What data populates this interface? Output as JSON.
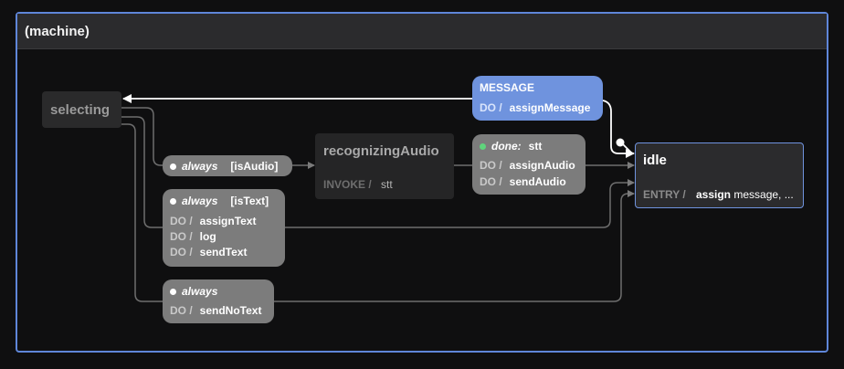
{
  "machine": {
    "title": "(machine)"
  },
  "states": {
    "selecting": {
      "name": "selecting"
    },
    "recognizing": {
      "name": "recognizingAudio",
      "invoke_label": "INVOKE /",
      "invoke_value": "stt"
    },
    "idle": {
      "name": "idle",
      "entry_label": "ENTRY /",
      "entry_action": "assign",
      "entry_rest": " message, ..."
    }
  },
  "transitions": {
    "message": {
      "event": "MESSAGE",
      "do_label": "DO /",
      "action": "assignMessage"
    },
    "always_audio": {
      "event": "always",
      "guard": "[isAudio]"
    },
    "always_text": {
      "event": "always",
      "guard": "[isText]",
      "do_label": "DO /",
      "actions": [
        "assignText",
        "log",
        "sendText"
      ]
    },
    "always_notext": {
      "event": "always",
      "do_label": "DO /",
      "action": "sendNoText"
    },
    "done_stt": {
      "event": "done:",
      "target": "stt",
      "do_label": "DO /",
      "actions": [
        "assignAudio",
        "sendAudio"
      ]
    }
  },
  "colors": {
    "machine_border": "#5f86d9",
    "idle_border": "#6f93de",
    "message_bg": "#6f93de",
    "transition_bg": "#7c7c7c",
    "edge": "#6e6e6e",
    "done_dot": "#5fd47c"
  }
}
